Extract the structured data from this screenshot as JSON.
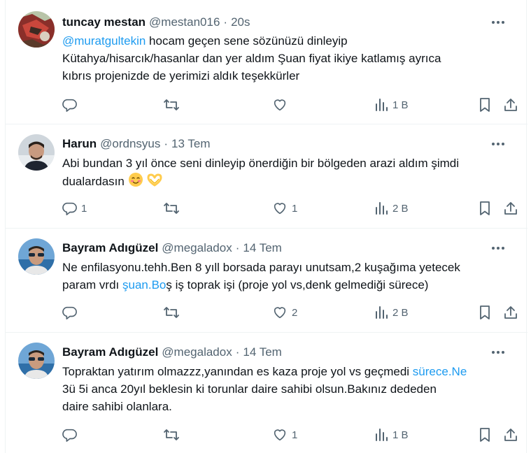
{
  "colors": {
    "text": "#0f1419",
    "secondary": "#536471",
    "link": "#1d9bf0",
    "divider": "#eff3f4"
  },
  "tweets": [
    {
      "name": "tuncay mestan",
      "handle": "@mestan016",
      "time": "20s",
      "mention": "@muratgultekin",
      "line1_rest": " hocam geçen sene sözünüzü dinleyip",
      "line2": "Kütahya/hisarcık/hasanlar dan yer aldım Şuan fiyat ikiye katlamış ayrıca",
      "line3": "kıbrıs projenizde de yerimizi aldık teşekkürler",
      "replies": "",
      "retweets": "",
      "likes": "",
      "views": "1 B"
    },
    {
      "name": "Harun",
      "handle": "@ordnsyus",
      "time": "13 Tem",
      "line1": "Abi bundan 3 yıl önce seni dinleyip önerdiğin bir bölgeden arazi aldım şimdi",
      "line2": "dualardasın",
      "replies": "1",
      "retweets": "",
      "likes": "1",
      "views": "2 B"
    },
    {
      "name": "Bayram Adıgüzel",
      "handle": "@megaladox",
      "time": "14 Tem",
      "line1": "Ne enfilasyonu.tehh.Ben 8 yıll borsada parayı unutsam,2 kuşağıma yetecek",
      "line2_pre": "param vrdı ",
      "line2_link": "şuan.Bo",
      "line2_post": "ş iş toprak işi (proje yol vs,denk gelmediği sürece)",
      "replies": "",
      "retweets": "",
      "likes": "2",
      "views": "2 B"
    },
    {
      "name": "Bayram Adıgüzel",
      "handle": "@megaladox",
      "time": "14 Tem",
      "line1_pre": "Topraktan yatırım olmazzz,yanından es kaza proje yol vs geçmedi ",
      "line1_link": "sürece.Ne",
      "line2": "3ü 5i anca 20yıl beklesin ki torunlar daire sahibi olsun.Bakınız dededen",
      "line3": "daire sahibi olanlara.",
      "replies": "",
      "retweets": "",
      "likes": "1",
      "views": "1 B"
    }
  ]
}
